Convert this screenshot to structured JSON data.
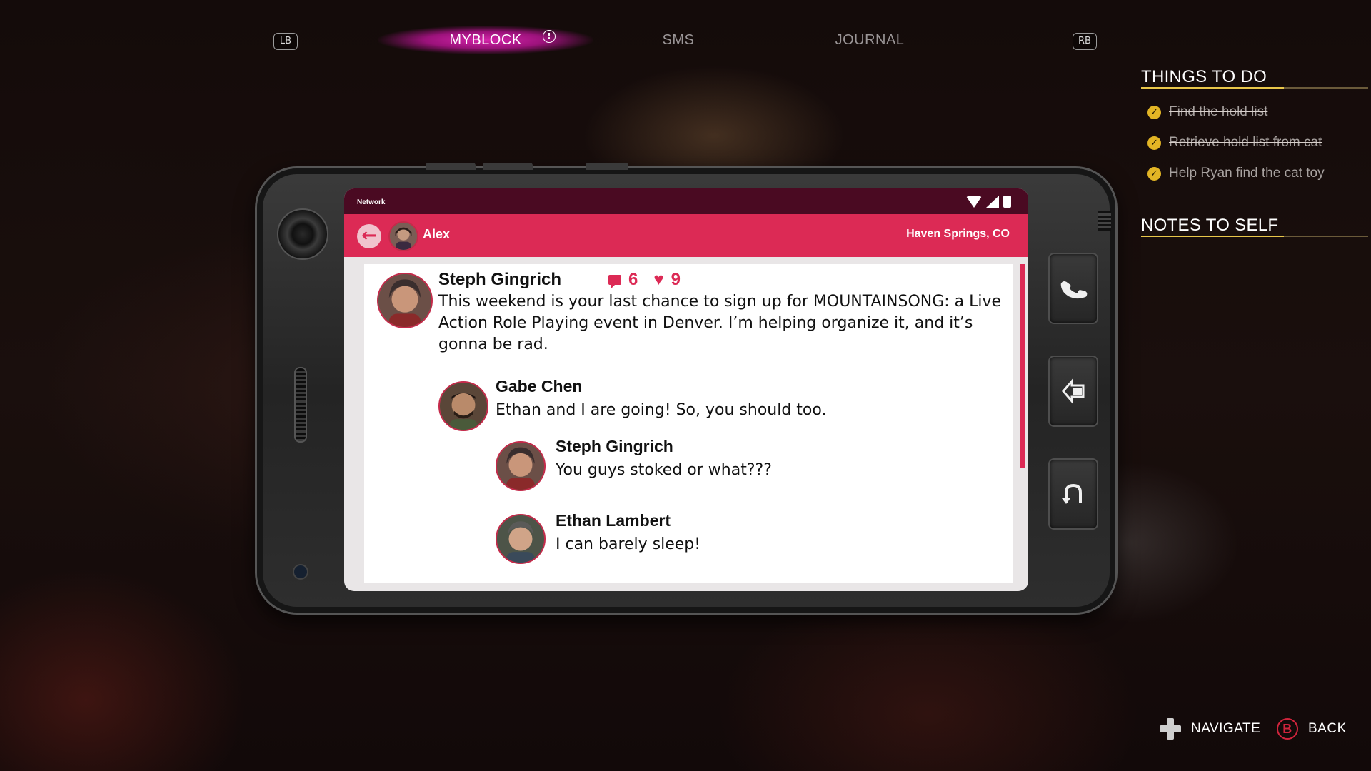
{
  "topnav": {
    "left_button": "LB",
    "right_button": "RB",
    "tabs": [
      {
        "label": "MYBLOCK",
        "active": true,
        "alert": true
      },
      {
        "label": "SMS",
        "active": false
      },
      {
        "label": "JOURNAL",
        "active": false
      }
    ],
    "accent_color": "#de26b2"
  },
  "side_panel": {
    "todo_title": "THINGS TO DO",
    "todos": [
      {
        "text": "Find the hold list",
        "done": true
      },
      {
        "text": "Retrieve hold list from cat",
        "done": true
      },
      {
        "text": "Help Ryan find the cat toy",
        "done": true
      }
    ],
    "notes_title": "NOTES TO SELF"
  },
  "phone": {
    "status_bar": {
      "network_label": "Network",
      "icons": [
        "wifi-icon",
        "signal-icon",
        "battery-icon"
      ]
    },
    "app_bar": {
      "user": "Alex",
      "location": "Haven Springs, CO",
      "color": "#dc2a55"
    },
    "post": {
      "author": "Steph Gingrich",
      "text": "This weekend is your last chance to sign up for MOUNTAINSONG: a Live Action Role Playing event in Denver. I’m helping organize it, and it’s gonna be rad.",
      "comments": "6",
      "likes": "9"
    },
    "replies": [
      {
        "author": "Gabe Chen",
        "text": "Ethan and I are going! So, you should too."
      },
      {
        "author": "Steph Gingrich",
        "text": "You guys stoked or what???"
      },
      {
        "author": "Ethan Lambert",
        "text": "I can barely sleep!"
      }
    ],
    "side_buttons": [
      "phone-icon",
      "select-icon",
      "undo-icon"
    ]
  },
  "hints": {
    "navigate": "NAVIGATE",
    "b_button": "B",
    "back": "BACK"
  }
}
